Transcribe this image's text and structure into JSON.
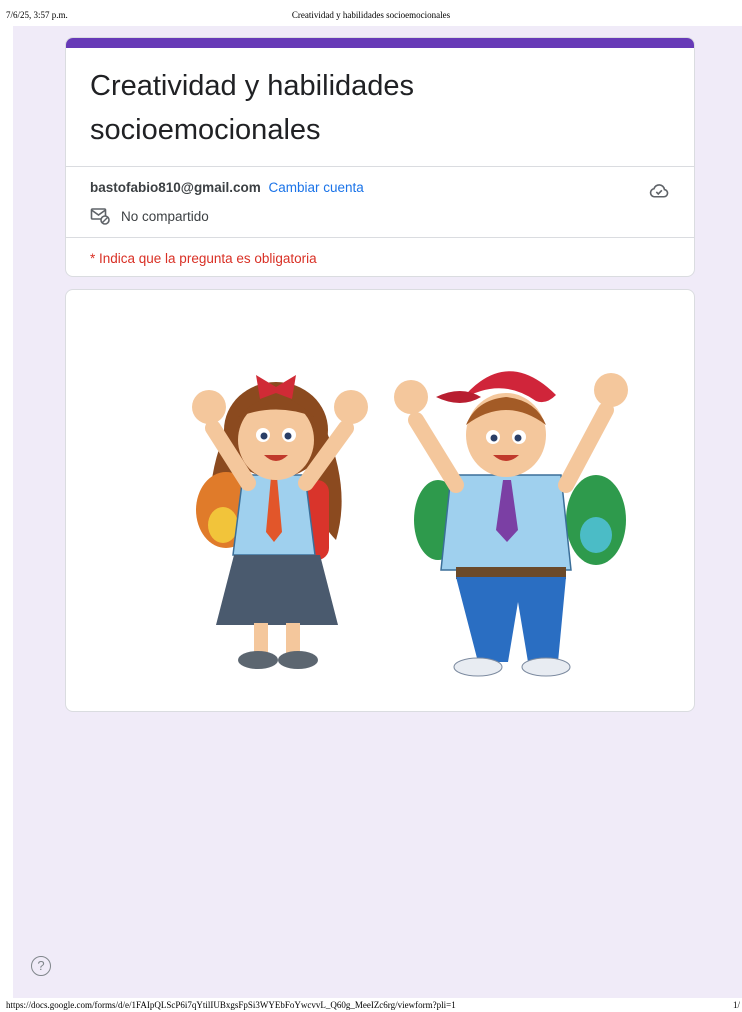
{
  "print_header": {
    "datetime": "7/6/25, 3:57 p.m.",
    "doc_title": "Creatividad y habilidades socioemocionales"
  },
  "form": {
    "title_line1": "Creatividad y habilidades",
    "title_line2": "socioemocionales",
    "accent_color": "#673ab7",
    "account_email": "bastofabio810@gmail.com",
    "switch_account_label": "Cambiar cuenta",
    "shared_status": "No compartido",
    "required_note": "* Indica que la pregunta es obligatoria"
  },
  "icons": {
    "cloud": "cloud-saved-icon",
    "shared": "not-shared-icon",
    "help": "help-icon"
  },
  "help_symbol": "?",
  "print_footer": {
    "url": "https://docs.google.com/forms/d/e/1FAIpQLScP6i7qYtilIUBxgsFpSi3WYEbFoYwcvvL_Q60g_MeeIZc6rg/viewform?pli=1",
    "page": "1/"
  }
}
